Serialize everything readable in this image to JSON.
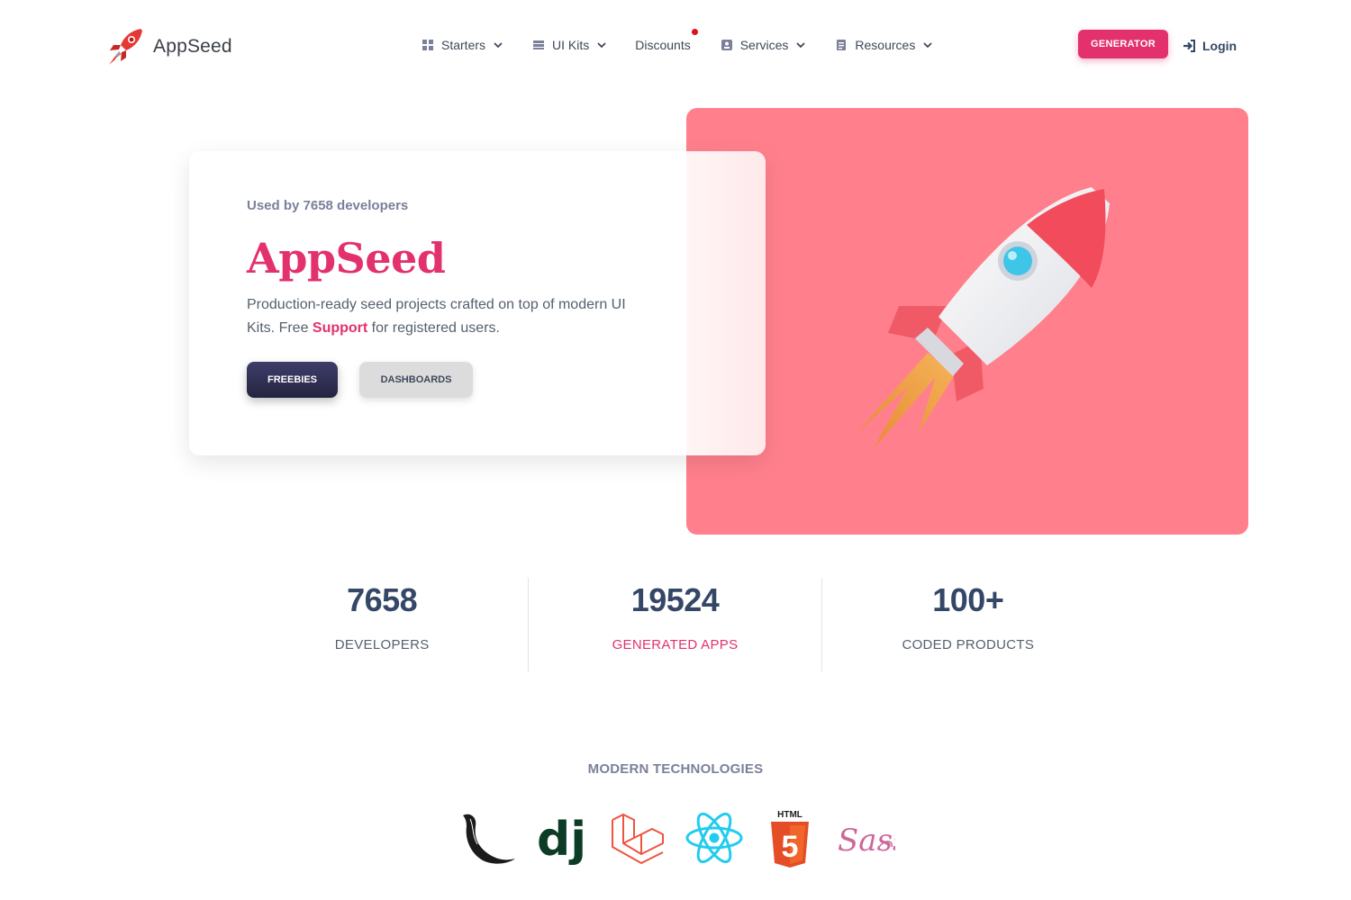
{
  "nav": {
    "brand": "AppSeed",
    "items": [
      {
        "label": "Starters",
        "icon": "grid-icon"
      },
      {
        "label": "UI Kits",
        "icon": "layers-icon"
      },
      {
        "label": "Discounts",
        "icon": ""
      },
      {
        "label": "Services",
        "icon": "badge-icon"
      },
      {
        "label": "Resources",
        "icon": "document-icon"
      }
    ],
    "generator_label": "GENERATOR",
    "login_label": "Login"
  },
  "hero": {
    "used_by": "Used by 7658 developers",
    "title": "AppSeed",
    "desc_before": "Production-ready seed projects crafted on top of modern UI Kits. Free ",
    "desc_link": "Support",
    "desc_after": " for registered users.",
    "btn_freebies": "FREEBIES",
    "btn_dashboards": "DASHBOARDS"
  },
  "stats": [
    {
      "value": "7658",
      "label": "DEVELOPERS"
    },
    {
      "value": "19524",
      "label": "GENERATED APPS"
    },
    {
      "value": "100+",
      "label": "CODED PRODUCTS"
    }
  ],
  "tech": {
    "title": "MODERN TECHNOLOGIES",
    "logos": [
      "flask-logo",
      "django-logo",
      "laravel-logo",
      "react-logo",
      "html5-logo",
      "sass-logo"
    ],
    "html5_text": "HTML",
    "html5_digit": "5",
    "django_text": "dj",
    "sass_text": "Sass"
  },
  "colors": {
    "accent": "#e3316d",
    "hero_bg": "#ff808c",
    "dark": "#344767",
    "notification_dot": "#e0101a"
  }
}
